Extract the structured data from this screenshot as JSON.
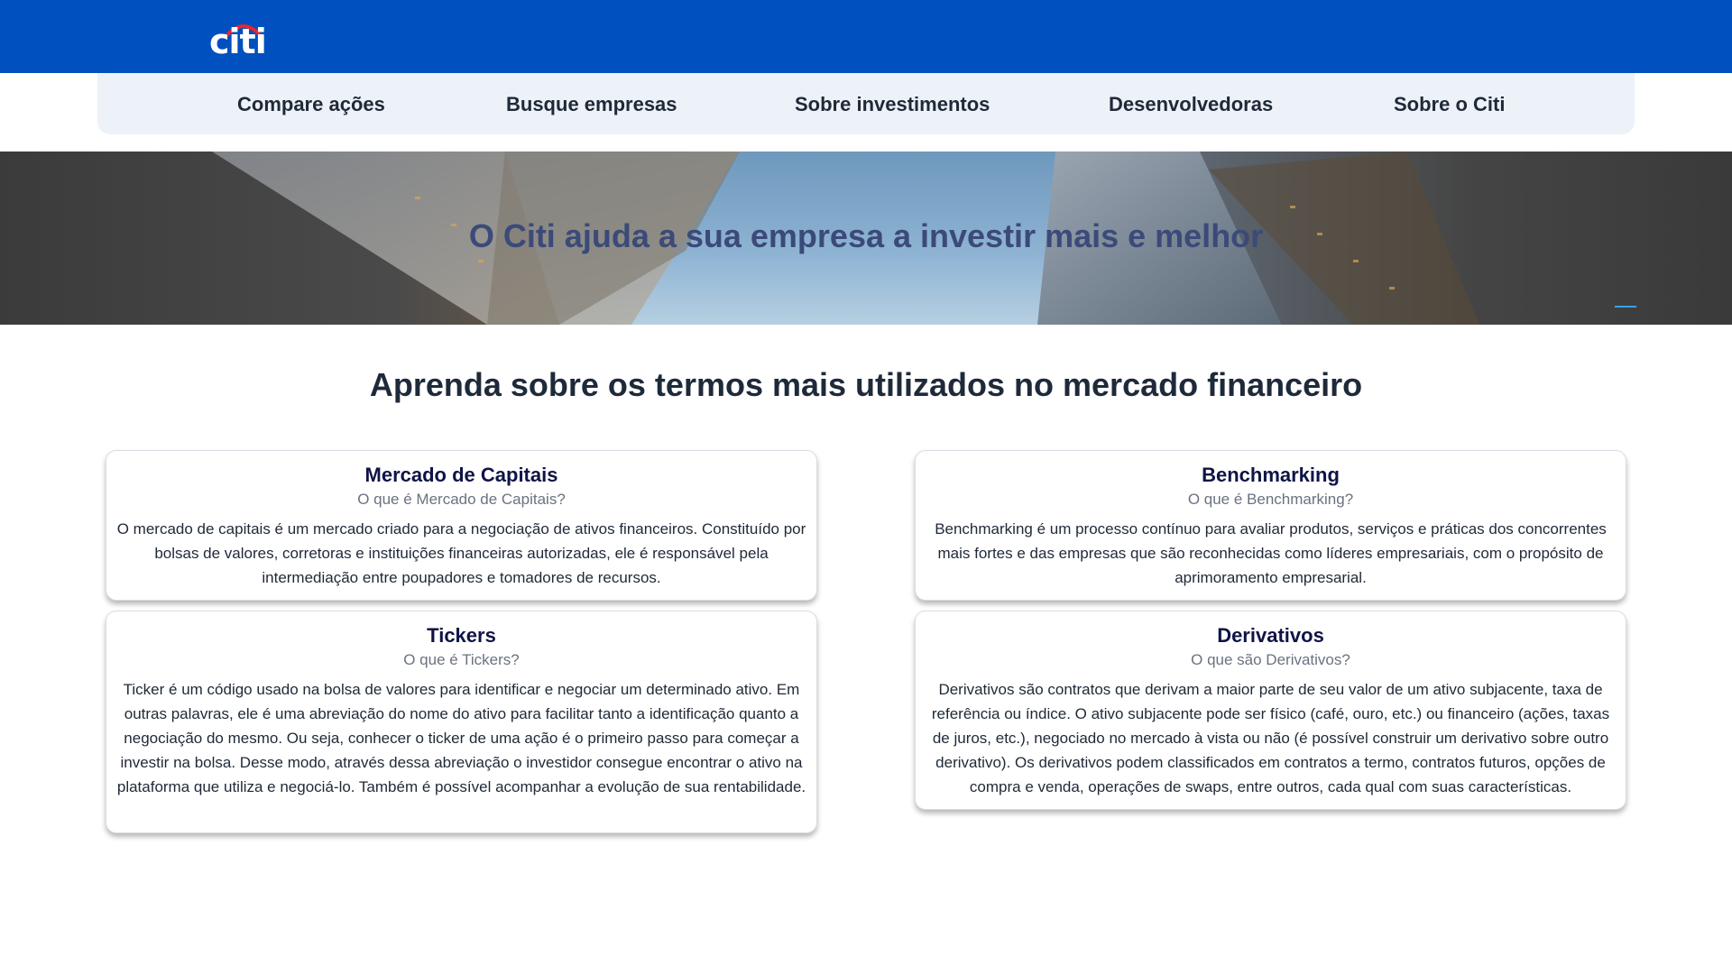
{
  "brand": {
    "logo_text": "citi",
    "logo_icon": "citi-arc-icon",
    "colors": {
      "primary": "#0050bf",
      "nav_bg": "#edf2f8",
      "arc": "#e8262d",
      "card_title": "#0f1446"
    }
  },
  "nav": {
    "items": [
      {
        "label": "Compare ações"
      },
      {
        "label": "Busque empresas"
      },
      {
        "label": "Sobre investimentos"
      },
      {
        "label": "Desenvolvedoras"
      },
      {
        "label": "Sobre o Citi"
      }
    ]
  },
  "hero": {
    "title": "O Citi ajuda a sua empresa a investir mais e melhor"
  },
  "section": {
    "title": "Aprenda sobre os termos mais utilizados no mercado financeiro"
  },
  "cards": [
    {
      "title": "Mercado de Capitais",
      "subtitle": "O que é Mercado de Capitais?",
      "body": "O mercado de capitais é um mercado criado para a negociação de ativos financeiros. Constituído por bolsas de valores, corretoras e instituições financeiras autorizadas, ele é responsável pela intermediação entre poupadores e tomadores de recursos."
    },
    {
      "title": "Benchmarking",
      "subtitle": "O que é Benchmarking?",
      "body": "Benchmarking é um processo contínuo para avaliar produtos, serviços e práticas dos concorrentes mais fortes e das empresas que são reconhecidas como líderes empresariais, com o propósito de aprimoramento empresarial."
    },
    {
      "title": "Tickers",
      "subtitle": "O que é Tickers?",
      "body": "Ticker é um código usado na bolsa de valores para identificar e negociar um determinado ativo. Em outras palavras, ele é uma abreviação do nome do ativo para facilitar tanto a identificação quanto a negociação do mesmo. Ou seja, conhecer o ticker de uma ação é o primeiro passo para começar a investir na bolsa. Desse modo, através dessa abreviação o investidor consegue encontrar o ativo na plataforma que utiliza e negociá-lo. Também é possível acompanhar a evolução de sua rentabilidade."
    },
    {
      "title": "Derivativos",
      "subtitle": "O que são Derivativos?",
      "body": "Derivativos são contratos que derivam a maior parte de seu valor de um ativo subjacente, taxa de referência ou índice. O ativo subjacente pode ser físico (café, ouro, etc.) ou financeiro (ações, taxas de juros, etc.), negociado no mercado à vista ou não (é possível construir um derivativo sobre outro derivativo). Os derivativos podem classificados em contratos a termo, contratos futuros, opções de compra e venda, operações de swaps, entre outros, cada qual com suas características."
    }
  ]
}
